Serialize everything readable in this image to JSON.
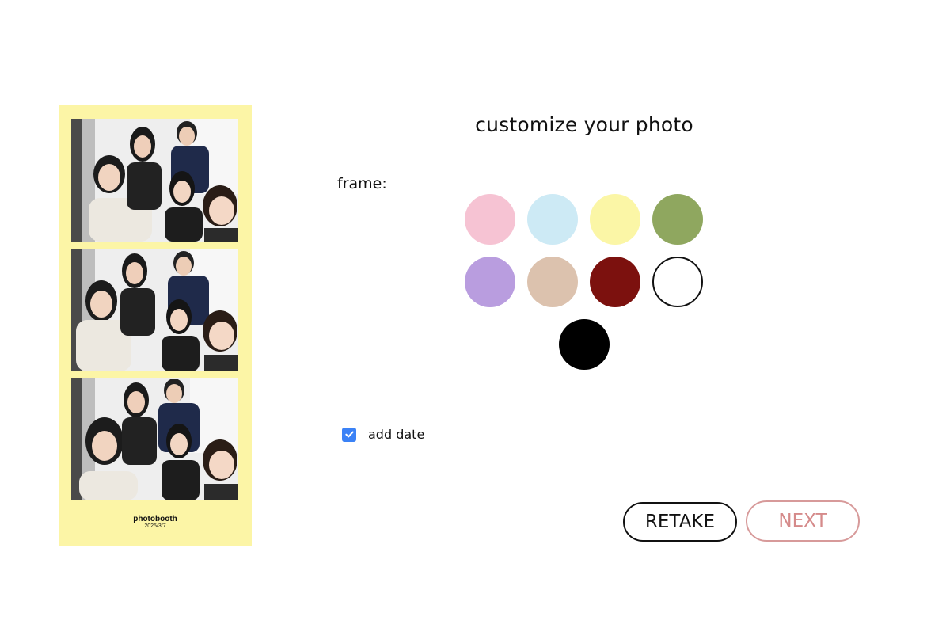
{
  "strip": {
    "frame_color": "#fcf5a6",
    "title": "photobooth",
    "date": "2025/3/7",
    "photos": [
      {
        "description": "group-photo-1"
      },
      {
        "description": "group-photo-2"
      },
      {
        "description": "group-photo-3"
      }
    ]
  },
  "panel": {
    "heading": "customize your photo",
    "frame_label": "frame:",
    "swatches": [
      {
        "name": "pink",
        "color": "#f6c3d3"
      },
      {
        "name": "light-blue",
        "color": "#cdeaf5"
      },
      {
        "name": "yellow",
        "color": "#fbf6a6"
      },
      {
        "name": "green",
        "color": "#8fa75f"
      },
      {
        "name": "lavender",
        "color": "#b99ddf"
      },
      {
        "name": "beige",
        "color": "#dcc2ae"
      },
      {
        "name": "maroon",
        "color": "#7c110e"
      },
      {
        "name": "white",
        "color": "#ffffff"
      },
      {
        "name": "black",
        "color": "#000000"
      }
    ],
    "add_date": {
      "label": "add date",
      "checked": true,
      "accent": "#3b82f6"
    },
    "buttons": {
      "retake": "RETAKE",
      "next": "NEXT"
    }
  }
}
